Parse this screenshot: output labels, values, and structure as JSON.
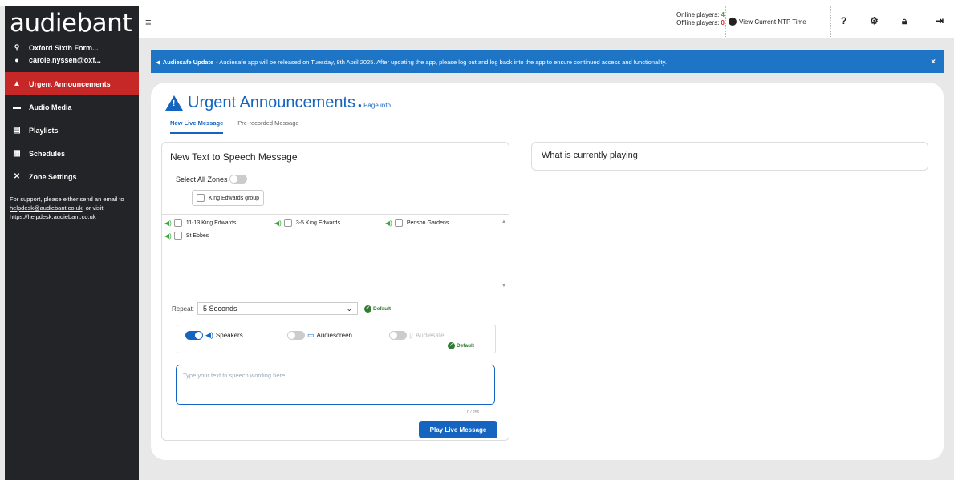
{
  "app": {
    "logo": "audiebant"
  },
  "user": {
    "site": "Oxford Sixth Form...",
    "email": "carole.nyssen@oxf..."
  },
  "sidebar": {
    "items": [
      {
        "label": "Urgent Announcements",
        "icon": "warning-icon"
      },
      {
        "label": "Audio Media",
        "icon": "folder-icon"
      },
      {
        "label": "Playlists",
        "icon": "list-icon"
      },
      {
        "label": "Schedules",
        "icon": "calendar-icon"
      },
      {
        "label": "Zone Settings",
        "icon": "tools-icon"
      }
    ],
    "support_text": "For support, please either send an email to",
    "support_email": "helpdesk@audiebant.co.uk",
    "support_mid": ", or visit",
    "support_link": "https://helpdesk.audiebant.co.uk"
  },
  "header": {
    "online_label": "Online players:",
    "online_count": "4",
    "offline_label": "Offline players:",
    "offline_count": "0",
    "ntp_label": "View Current NTP Time",
    "hamburger": "≡"
  },
  "banner": {
    "title": "Audiesafe Update",
    "text": "- Audiesafe app will be released on Tuesday, 8th April 2025. After updating the app, please log out and log back into the app to ensure continued access and functionality.",
    "close": "×"
  },
  "page": {
    "title": "Urgent Announcements",
    "page_info": "Page info",
    "tabs": [
      "New Live Message",
      "Pre-recorded Message"
    ]
  },
  "tts_panel": {
    "heading": "New Text to Speech Message",
    "select_all": "Select All Zones",
    "group": "King Edwards group",
    "zones": [
      "11-13 King Edwards",
      "3-5 King Edwards",
      "Penson Gardens",
      "St Ebbes"
    ],
    "repeat_label": "Repeat:",
    "repeat_value": "5 Seconds",
    "default_label": "Default",
    "outputs": [
      {
        "label": "Speakers",
        "enabled": true
      },
      {
        "label": "Audiescreen",
        "enabled": false
      },
      {
        "label": "Audiesafe",
        "enabled": false
      }
    ],
    "text_placeholder": "Type your text to speech wording here",
    "counter": "0 / 256",
    "play_button": "Play Live Message"
  },
  "playing_panel": {
    "heading": "What is currently playing"
  },
  "colors": {
    "accent": "#1565c0",
    "active_nav": "#c62828",
    "sidebar": "#232427",
    "banner": "#1f75c5",
    "online": "#3aa63a",
    "offline": "#d32f2f"
  }
}
